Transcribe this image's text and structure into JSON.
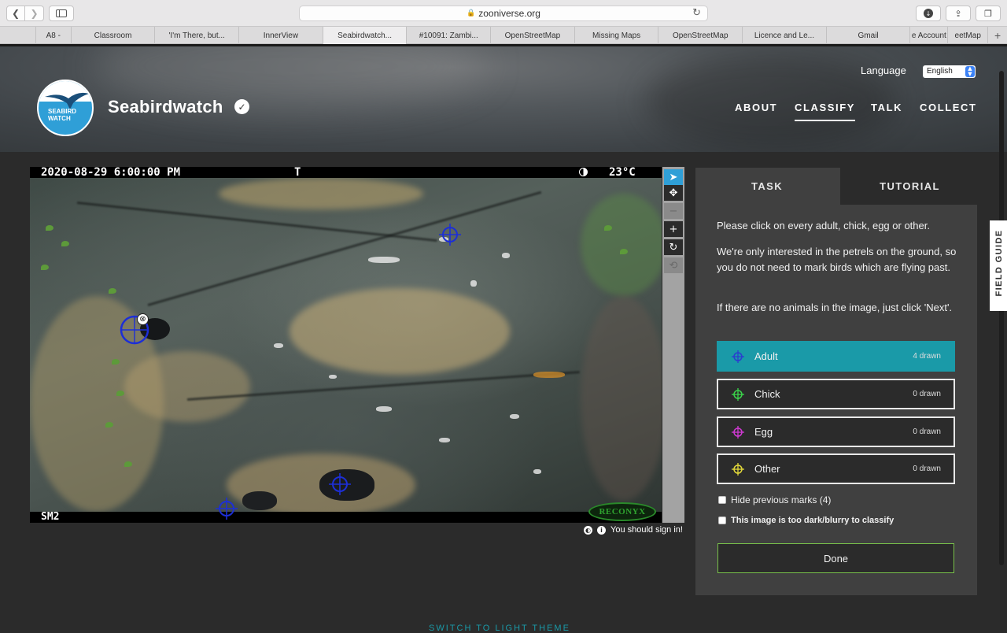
{
  "browser": {
    "url": "zooniverse.org",
    "tabs": [
      {
        "label": "",
        "width": 46
      },
      {
        "label": "A8 -",
        "width": 45
      },
      {
        "label": "Classroom",
        "width": 107
      },
      {
        "label": "'I'm There, but...",
        "width": 107
      },
      {
        "label": "InnerView",
        "width": 107
      },
      {
        "label": "Seabirdwatch...",
        "width": 107,
        "active": true
      },
      {
        "label": "#10091: Zambi...",
        "width": 107
      },
      {
        "label": "OpenStreetMap",
        "width": 107
      },
      {
        "label": "Missing Maps",
        "width": 107
      },
      {
        "label": "OpenStreetMap",
        "width": 107
      },
      {
        "label": "Licence and Le...",
        "width": 107
      },
      {
        "label": "Gmail",
        "width": 107
      },
      {
        "label": "e Account",
        "width": 48
      },
      {
        "label": "eetMap",
        "width": 51
      }
    ],
    "new_tab": "+"
  },
  "header": {
    "project_title": "Seabirdwatch",
    "logo_text_line1": "SEABIRD",
    "logo_text_line2": "WATCH",
    "verified_mark": "✓",
    "language_label": "Language",
    "language_value": "English",
    "nav": [
      {
        "label": "ABOUT",
        "active": false
      },
      {
        "label": "CLASSIFY",
        "active": true
      },
      {
        "label": "TALK",
        "active": false
      },
      {
        "label": "COLLECT",
        "active": false
      }
    ]
  },
  "subject": {
    "stamp_datetime": "2020-08-29  6:00:00 PM",
    "stamp_flag": "T",
    "stamp_moon_icon": "moon-phase-icon",
    "stamp_temp": "23°C",
    "stamp_camera": "SM2",
    "brand": "RECONYX",
    "marks": [
      {
        "id": "adult-1",
        "color": "#1d2fd6"
      },
      {
        "id": "adult-2",
        "color": "#1d2fd6"
      },
      {
        "id": "adult-3",
        "color": "#1d2fd6"
      },
      {
        "id": "adult-4",
        "color": "#1d2fd6"
      }
    ],
    "selected_mark_delete": "⊗",
    "sign_in_prompt": "You should sign in!"
  },
  "toolbar": {
    "tools": [
      {
        "name": "pointer",
        "glyph": "➤",
        "active": true
      },
      {
        "name": "pan",
        "glyph": "✥"
      },
      {
        "name": "zoom-out",
        "glyph": "−",
        "disabled": true
      },
      {
        "name": "zoom-in",
        "glyph": "+"
      },
      {
        "name": "rotate",
        "glyph": "↻"
      },
      {
        "name": "reset",
        "glyph": "⟲",
        "disabled": true
      }
    ]
  },
  "task_panel": {
    "tab_task": "TASK",
    "tab_tutorial": "TUTORIAL",
    "instructions": [
      "Please click on every adult, chick, egg or other.",
      "We're only interested in the petrels on the ground, so you do not need to mark birds which are flying past.",
      "If there are no animals in the image, just click 'Next'."
    ],
    "choices": [
      {
        "label": "Adult",
        "count": "4 drawn",
        "color": "#2b3ccf",
        "selected": true
      },
      {
        "label": "Chick",
        "count": "0 drawn",
        "color": "#3bd44a",
        "selected": false
      },
      {
        "label": "Egg",
        "count": "0 drawn",
        "color": "#d13ad4",
        "selected": false
      },
      {
        "label": "Other",
        "count": "0 drawn",
        "color": "#e3d93a",
        "selected": false
      }
    ],
    "hide_marks_label": "Hide previous marks (4)",
    "too_dark_label": "This image is too dark/blurry to classify",
    "done_label": "Done",
    "field_guide": "FIELD GUIDE"
  },
  "footer": {
    "theme_switch": "SWITCH TO LIGHT THEME"
  },
  "colors": {
    "accent_teal": "#1a9aa8",
    "done_border": "#78c04a",
    "panel_bg": "#404040",
    "page_bg": "#2b2b2b",
    "mark_blue": "#1d2fd6"
  }
}
